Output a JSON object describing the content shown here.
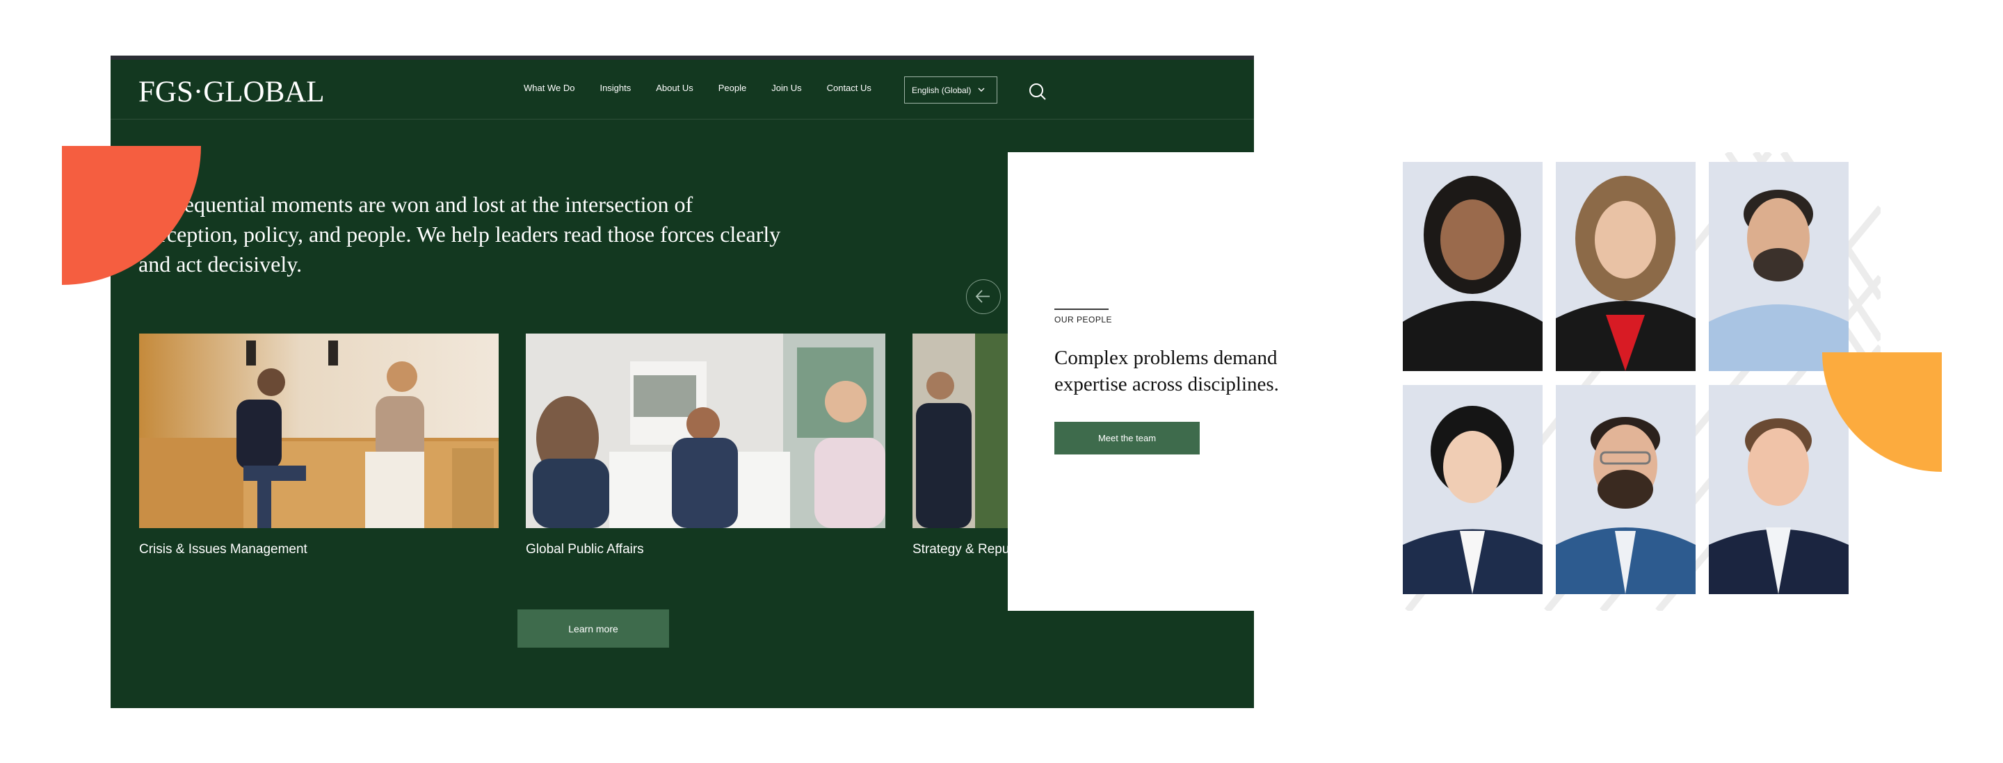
{
  "site": {
    "logo": "FGS·GLOBAL",
    "nav": [
      "What We Do",
      "Insights",
      "About Us",
      "People",
      "Join Us",
      "Contact Us"
    ],
    "language": "English (Global)",
    "headline": "Consequential moments are won and lost at the intersection of perception, policy, and people. We help leaders read those forces clearly and act decisively.",
    "cards": [
      {
        "caption": "Crisis & Issues Management"
      },
      {
        "caption": "Global Public Affairs"
      },
      {
        "caption": "Strategy & Reputation"
      }
    ],
    "learn_more": "Learn more"
  },
  "people": {
    "label": "OUR PEOPLE",
    "heading": "Complex problems demand expertise across disciplines.",
    "cta": "Meet the team"
  },
  "colors": {
    "brand_green": "#133820",
    "button_green": "#3e6b4c",
    "accent_red": "#f55e40",
    "accent_orange": "#fcab3e"
  }
}
